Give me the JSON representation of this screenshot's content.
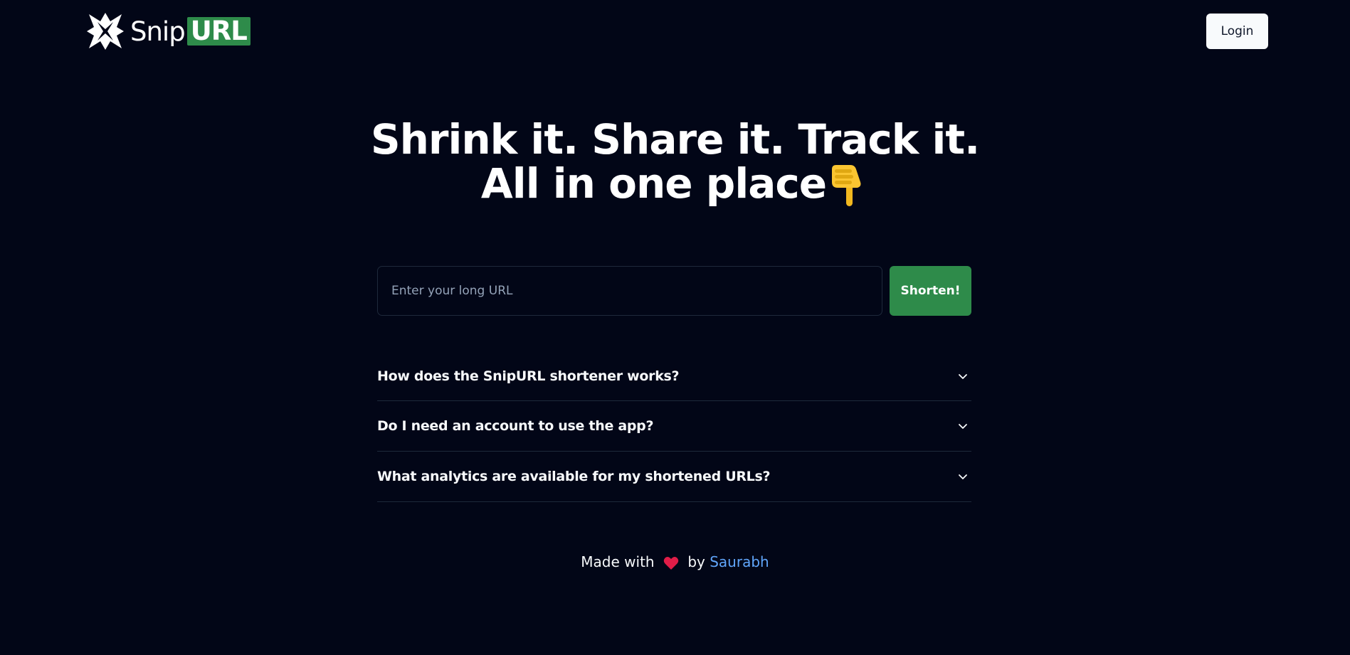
{
  "header": {
    "logo": {
      "text_main": "Snip",
      "text_highlight": "URL",
      "icon": "star-x-logo-icon"
    },
    "login_label": "Login"
  },
  "hero": {
    "line1": "Shrink it. Share it. Track it.",
    "line2": "All in one place",
    "emoji_icon": "pointing-down-hand-icon"
  },
  "form": {
    "placeholder": "Enter your long URL",
    "value": "",
    "submit_label": "Shorten!"
  },
  "faq": {
    "items": [
      {
        "question": "How does the SnipURL shortener works?"
      },
      {
        "question": "Do I need an account to use the app?"
      },
      {
        "question": "What analytics are available for my shortened URLs?"
      }
    ]
  },
  "footer": {
    "prefix": "Made with",
    "heart_icon": "heart-icon",
    "by": "by",
    "author": "Saurabh"
  },
  "colors": {
    "background": "#020617",
    "accent": "#2e8b4a",
    "link": "#60a5fa",
    "border": "#1e293b"
  }
}
